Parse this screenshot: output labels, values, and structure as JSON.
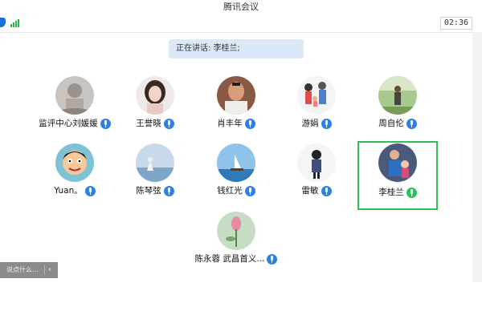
{
  "window": {
    "title": "腾讯会议"
  },
  "toolbar": {
    "time": "02:36"
  },
  "speaking": {
    "text": "正在讲话: 李桂兰;"
  },
  "participants": [
    {
      "name": "监评中心刘媛媛",
      "avatar": "misty-figure-photo",
      "mic": "on"
    },
    {
      "name": "王誉晓",
      "avatar": "girl-portrait-photo",
      "mic": "on"
    },
    {
      "name": "肖丰年",
      "avatar": "man-portrait-photo",
      "mic": "on"
    },
    {
      "name": "游娟",
      "avatar": "family-cartoon",
      "mic": "on"
    },
    {
      "name": "周自伦",
      "avatar": "outdoor-man-photo",
      "mic": "on"
    },
    {
      "name": "Yuan。",
      "avatar": "cartoon-boy",
      "mic": "on"
    },
    {
      "name": "陈琴弦",
      "avatar": "sea-girl-photo",
      "mic": "on"
    },
    {
      "name": "钱红光",
      "avatar": "sailboat-photo",
      "mic": "on"
    },
    {
      "name": "雷敏",
      "avatar": "cartoon-girl",
      "mic": "on"
    },
    {
      "name": "李桂兰",
      "avatar": "man-with-child-photo",
      "mic": "speaking",
      "active": true
    },
    {
      "name": "陈永蓉 武昌首义...",
      "avatar": "lotus-photo",
      "mic": "on"
    }
  ],
  "chat": {
    "placeholder": "说点什么...",
    "collapse_icon": "chevron-left-icon"
  },
  "colors": {
    "speaking_border": "#2fbf5b",
    "mic_on": "#2f7fe5",
    "mic_speaking": "#2fbf5b",
    "speaking_banner": "#dbe8f8"
  }
}
